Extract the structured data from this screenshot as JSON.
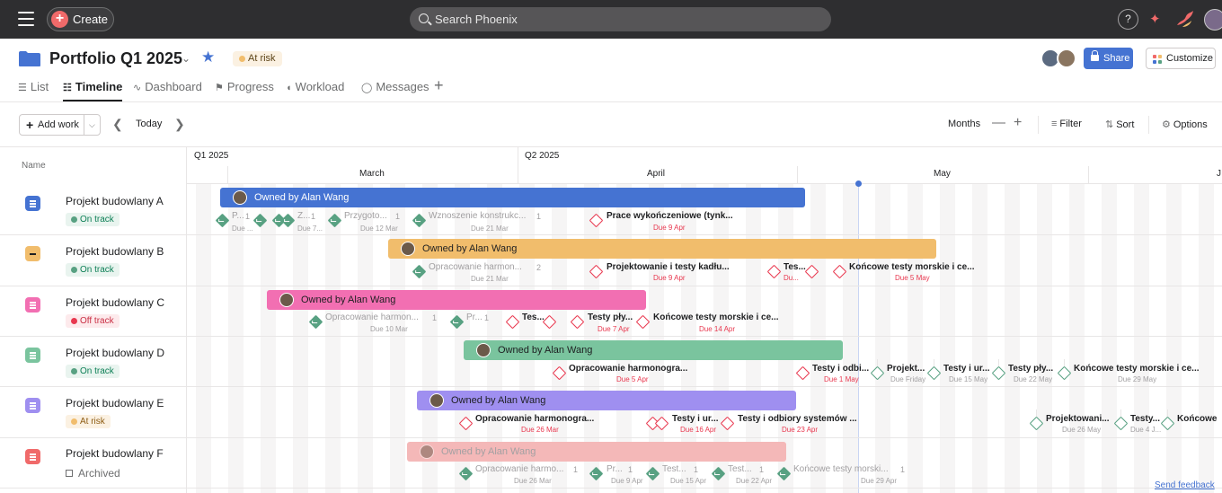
{
  "topbar": {
    "create_label": "Create",
    "search_placeholder": "Search Phoenix",
    "help_label": "?"
  },
  "project": {
    "title": "Portfolio Q1 2025",
    "status": "At risk",
    "share_label": "Share",
    "customize_label": "Customize"
  },
  "tabs": [
    {
      "label": "List",
      "icon": "list-icon"
    },
    {
      "label": "Timeline",
      "icon": "timeline-icon",
      "active": true
    },
    {
      "label": "Dashboard",
      "icon": "dashboard-icon"
    },
    {
      "label": "Progress",
      "icon": "progress-icon"
    },
    {
      "label": "Workload",
      "icon": "workload-icon"
    },
    {
      "label": "Messages",
      "icon": "messages-icon"
    }
  ],
  "toolbar": {
    "add_work_label": "Add work",
    "today_label": "Today",
    "zoom_label": "Months",
    "filter_label": "Filter",
    "sort_label": "Sort",
    "options_label": "Options"
  },
  "timeline": {
    "name_column": "Name",
    "quarters": [
      "Q1 2025",
      "Q2 2025"
    ],
    "months": [
      "March",
      "April",
      "May",
      "J"
    ]
  },
  "rows": [
    {
      "name": "Projekt budowlany A",
      "status": "On track",
      "bar_label": "Owned by Alan Wang",
      "milestones": [
        {
          "label": "P...",
          "due": "Due ..."
        },
        {
          "label": "Z...",
          "due": "Due 7..."
        },
        {
          "label": "Przygoto...",
          "due": "Due 12 Mar"
        },
        {
          "label": "Wznoszenie konstrukc...",
          "due": "Due 21 Mar"
        },
        {
          "label": "Prace wykończeniowe (tynk...",
          "due": "Due 9 Apr"
        }
      ],
      "subtasks": [
        "1",
        "1",
        "1",
        "1"
      ]
    },
    {
      "name": "Projekt budowlany B",
      "status": "On track",
      "bar_label": "Owned by Alan Wang",
      "milestones": [
        {
          "label": "Opracowanie harmon...",
          "due": "Due 21 Mar"
        },
        {
          "label": "Projektowanie i testy kadłu...",
          "due": "Due 9 Apr"
        },
        {
          "label": "Tes...",
          "due": "Du..."
        },
        {
          "label": "Końcowe testy morskie i ce...",
          "due": "Due 5 May"
        }
      ],
      "subtasks": [
        "2"
      ]
    },
    {
      "name": "Projekt budowlany C",
      "status": "Off track",
      "bar_label": "Owned by Alan Wang",
      "milestones": [
        {
          "label": "Opracowanie harmon...",
          "due": "Due 10 Mar"
        },
        {
          "label": "Pr...",
          "due": ""
        },
        {
          "label": "Tes...",
          "due": ""
        },
        {
          "label": "Testy pły...",
          "due": "Due 7 Apr"
        },
        {
          "label": "Końcowe testy morskie i ce...",
          "due": "Due 14 Apr"
        }
      ],
      "subtasks": [
        "1",
        "1"
      ]
    },
    {
      "name": "Projekt budowlany D",
      "status": "On track",
      "bar_label": "Owned by Alan Wang",
      "milestones": [
        {
          "label": "Opracowanie harmonogra...",
          "due": "Due 5 Apr"
        },
        {
          "label": "Testy i odbi...",
          "due": "Due 1 May"
        },
        {
          "label": "Projekt...",
          "due": "Due Friday"
        },
        {
          "label": "Testy i ur...",
          "due": "Due 15 May"
        },
        {
          "label": "Testy pły...",
          "due": "Due 22 May"
        },
        {
          "label": "Końcowe testy morskie i ce...",
          "due": "Due 29 May"
        }
      ]
    },
    {
      "name": "Projekt budowlany E",
      "status": "At risk",
      "bar_label": "Owned by Alan Wang",
      "milestones": [
        {
          "label": "Opracowanie harmonogra...",
          "due": "Due 26 Mar"
        },
        {
          "label": "Testy i ur...",
          "due": "Due 16 Apr"
        },
        {
          "label": "Testy i odbiory systemów ...",
          "due": "Due 23 Apr"
        },
        {
          "label": "Projektowani...",
          "due": "Due 26 May"
        },
        {
          "label": "Testy...",
          "due": "Due 4 J..."
        },
        {
          "label": "Końcowe",
          "due": ""
        }
      ]
    },
    {
      "name": "Projekt budowlany F",
      "status": "Archived",
      "bar_label": "Owned by Alan Wang",
      "milestones": [
        {
          "label": "Opracowanie harmo...",
          "due": "Due 26 Mar"
        },
        {
          "label": "Pr...",
          "due": "Due 9 Apr"
        },
        {
          "label": "Test...",
          "due": "Due 15 Apr"
        },
        {
          "label": "Test...",
          "due": "Due 22 Apr"
        },
        {
          "label": "Końcowe testy morski...",
          "due": "Due 29 Apr"
        }
      ],
      "subtasks": [
        "1",
        "1",
        "1",
        "1",
        "1"
      ]
    }
  ],
  "colors": {
    "blue": "#4573d2",
    "yellow": "#f1bd6c",
    "pink": "#f26fb2",
    "green": "#7ac49e",
    "purple": "#9f8ff0",
    "red": "#f06a6a",
    "done": "#58a182",
    "overdue": "#e8384f"
  },
  "feedback_label": "Send feedback"
}
